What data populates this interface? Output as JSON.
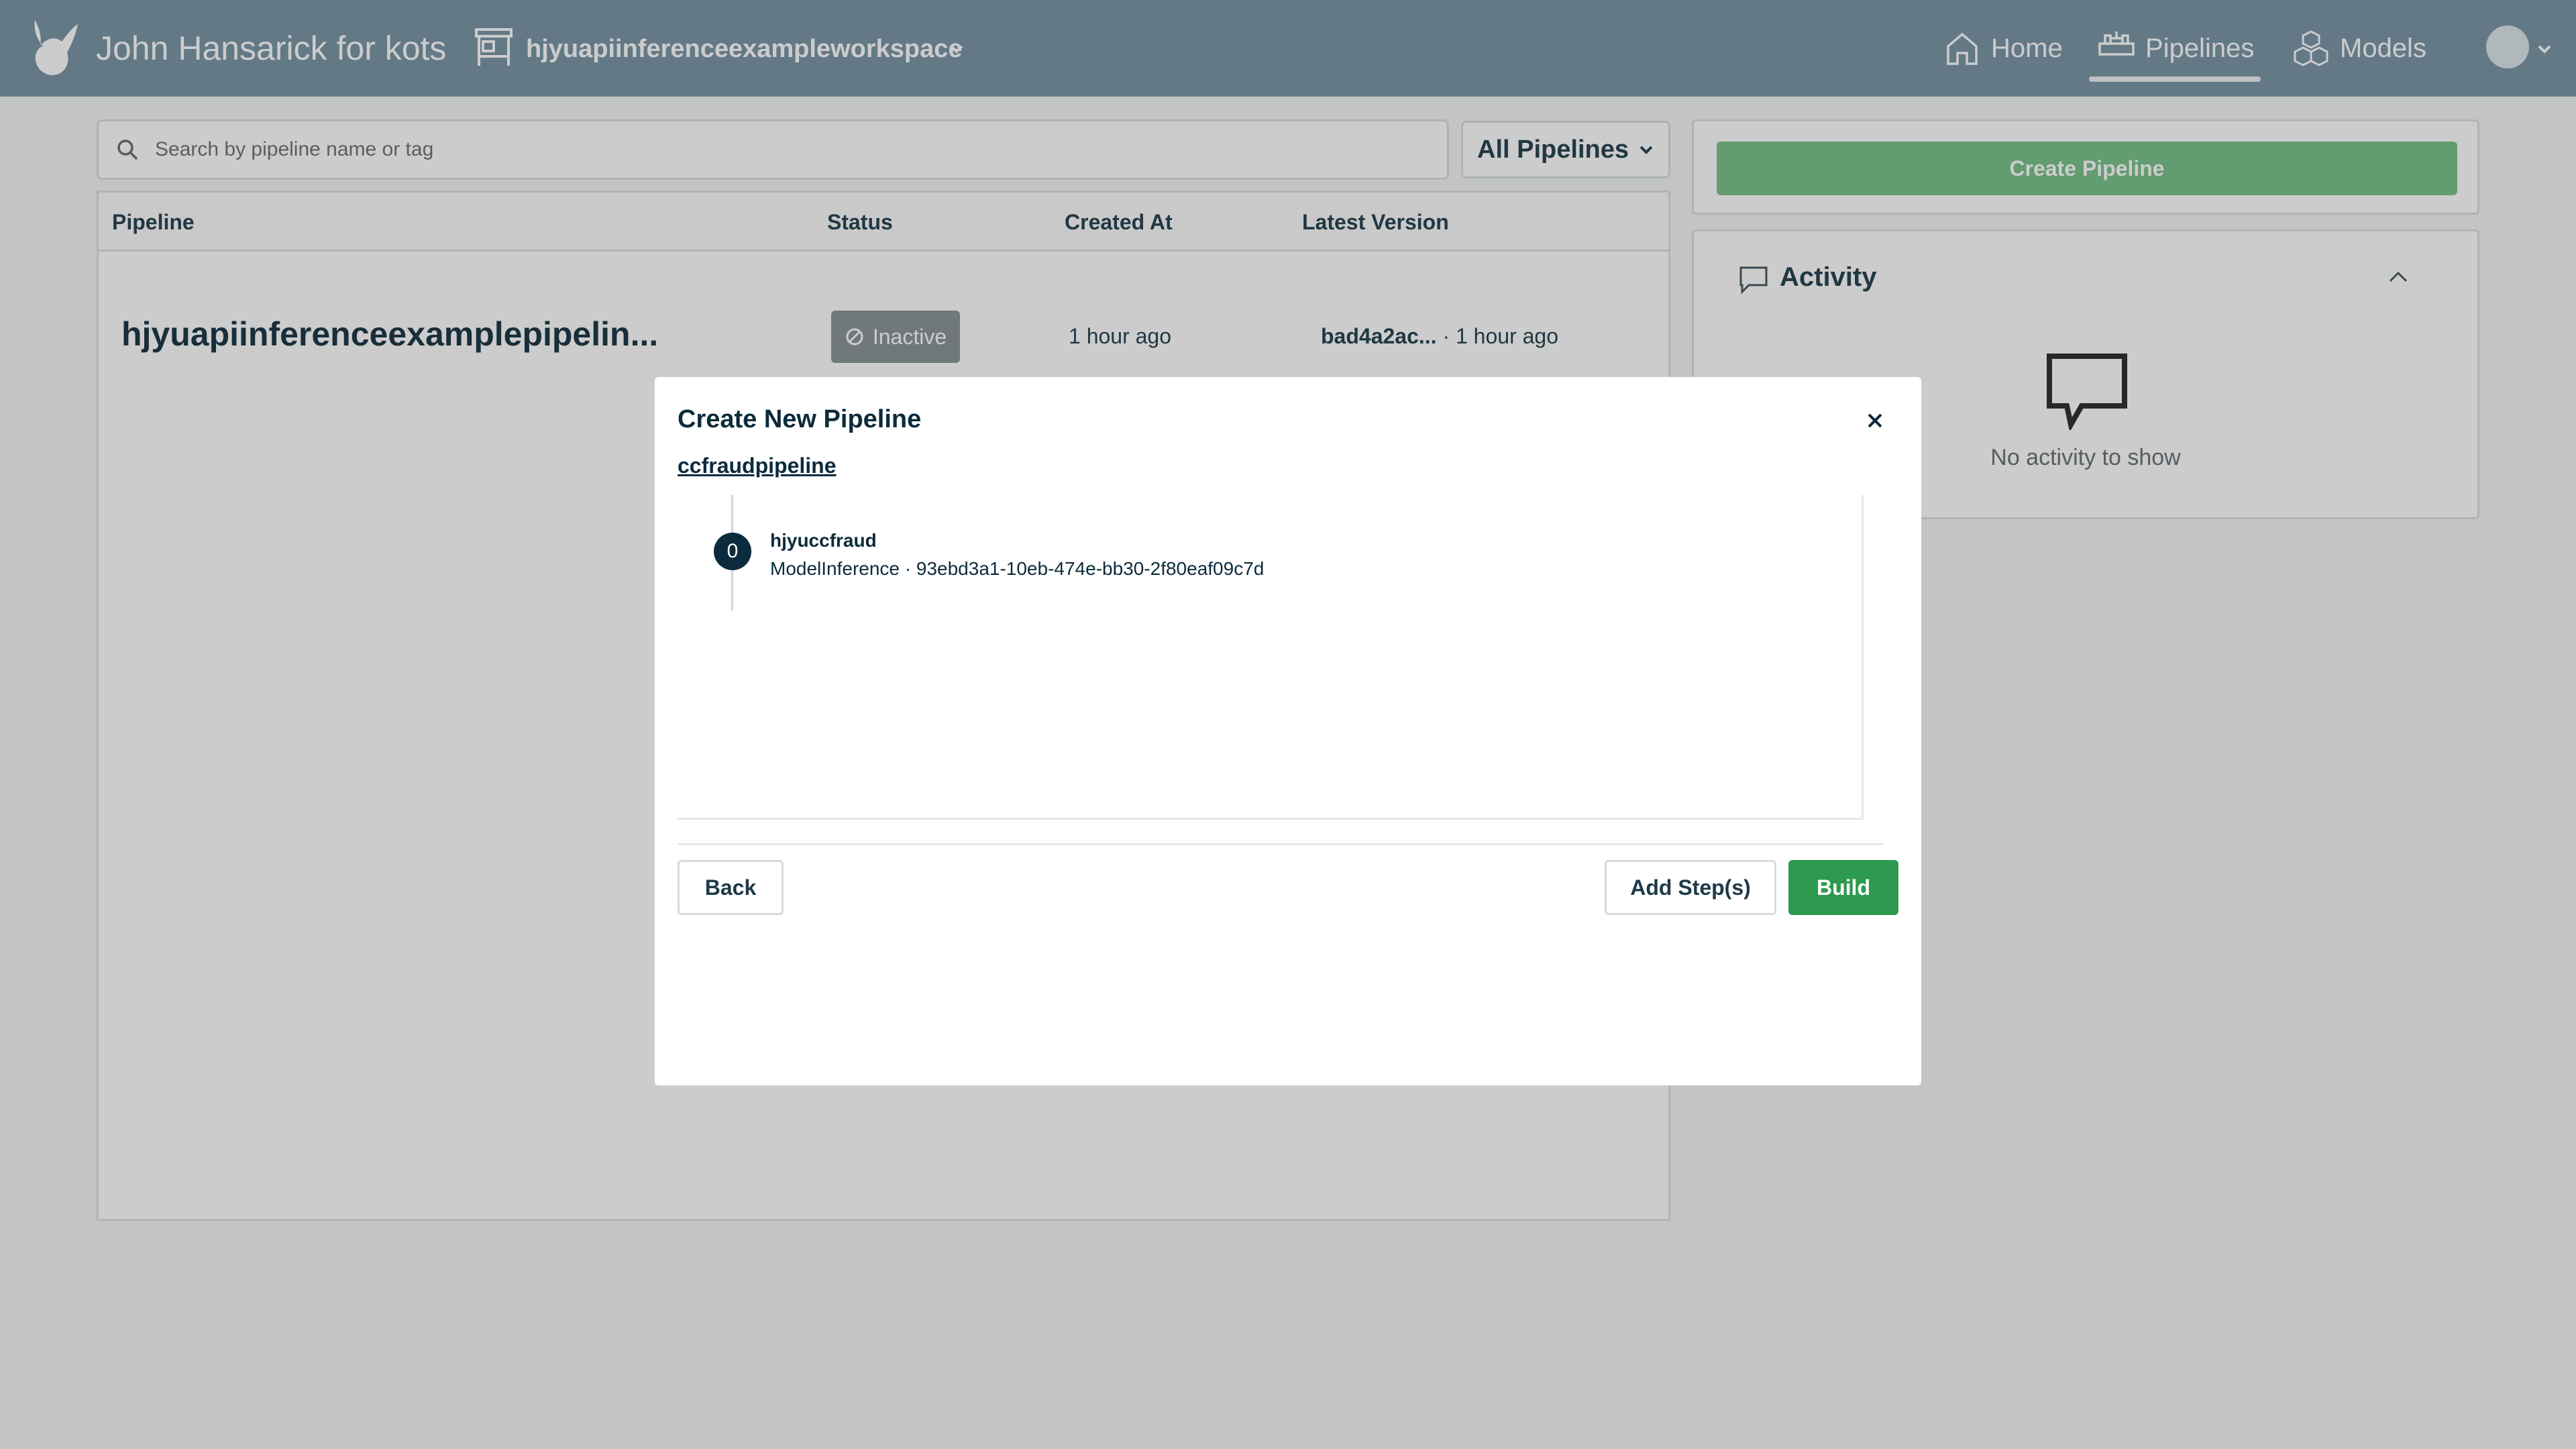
{
  "header": {
    "brand_name": "John Hansarick for kots",
    "workspace_name": "hjyuapiinferenceexampleworkspace",
    "nav": {
      "home": "Home",
      "pipelines": "Pipelines",
      "models": "Models"
    },
    "active_nav": "Pipelines"
  },
  "search": {
    "placeholder": "Search by pipeline name or tag"
  },
  "filter": {
    "selected": "All Pipelines"
  },
  "table": {
    "columns": [
      "Pipeline",
      "Status",
      "Created At",
      "Latest Version"
    ],
    "rows": [
      {
        "pipeline": "hjyuapiinferenceexamplepipelin...",
        "status": "Inactive",
        "created_at": "1 hour ago",
        "version_hash": "bad4a2ac...",
        "version_time": " · 1 hour ago"
      }
    ]
  },
  "sidebar": {
    "create_button": "Create Pipeline",
    "activity_title": "Activity",
    "activity_empty": "No activity to show"
  },
  "modal": {
    "title": "Create New Pipeline",
    "pipeline_name": "ccfraudpipeline",
    "steps": [
      {
        "index": "0",
        "name": "hjyuccfraud",
        "detail": "ModelInference · 93ebd3a1-10eb-474e-bb30-2f80eaf09c7d"
      }
    ],
    "back_label": "Back",
    "add_steps_label": "Add Step(s)",
    "build_label": "Build"
  },
  "colors": {
    "nav_bg": "#7c98a8",
    "primary_green": "#2d9a4f",
    "create_green": "#7bc38d",
    "inactive_badge": "#8c969b",
    "dark_text": "#0c2b3c"
  }
}
